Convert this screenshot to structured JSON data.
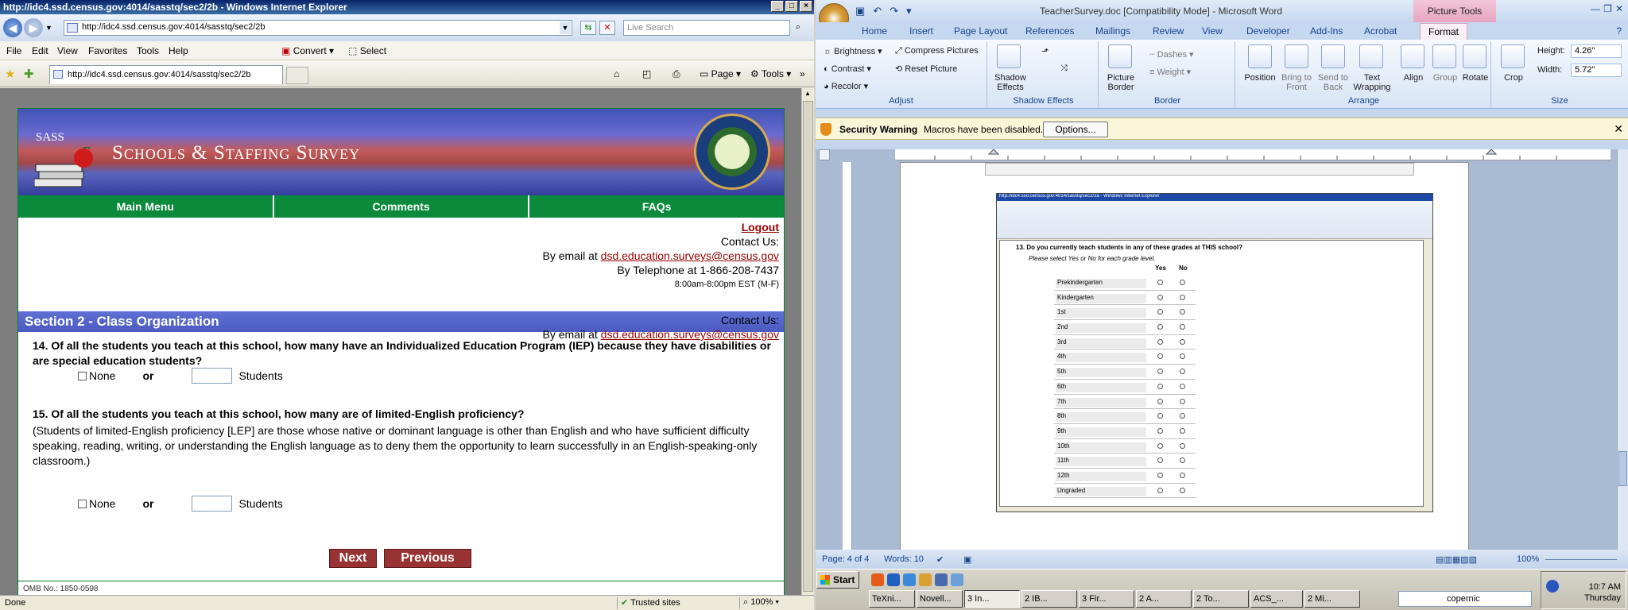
{
  "ie": {
    "window_title": "http://idc4.ssd.census.gov:4014/sasstq/sec2/2b - Windows Internet Explorer",
    "address": "http://idc4.ssd.census.gov:4014/sasstq/sec2/2b",
    "search_placeholder": "Live Search",
    "menu": [
      "File",
      "Edit",
      "View",
      "Favorites",
      "Tools",
      "Help"
    ],
    "convert_label": "Convert",
    "select_label": "Select",
    "tab_title": "http://idc4.ssd.census.gov:4014/sasstq/sec2/2b",
    "page_label": "Page",
    "tools_label": "Tools",
    "status": {
      "done": "Done",
      "zone": "Trusted sites",
      "zoom": "100%"
    }
  },
  "survey": {
    "sass": "SASS",
    "title": "Schools & Staffing Survey",
    "nav": [
      "Main Menu",
      "Comments",
      "FAQs"
    ],
    "logout": "Logout",
    "contact_label": "Contact Us:",
    "email_prefix": "By email at",
    "email": "dsd.education.surveys@census.gov",
    "phone": "By Telephone at 1-866-208-7437",
    "hours": "8:00am-8:00pm EST (M-F)",
    "section_title": "Section 2 - Class Organization",
    "q14": "14. Of all the students you teach at this school, how many have an Individualized Education Program (IEP) because they have disabilities or are special education students?",
    "q15": "15. Of all the students you teach at this school, how many are of limited-English proficiency?",
    "q15_note": "(Students of limited-English proficiency [LEP] are those whose native or dominant language is other than English and who have sufficient difficulty speaking, reading, writing, or understanding the English language as to deny them the opportunity to learn successfully in an English-speaking-only classroom.)",
    "none_label": "None",
    "or_label": "or",
    "students_label": "Students",
    "next": "Next",
    "previous": "Previous",
    "omb": "OMB No.: 1850-0598"
  },
  "word": {
    "title": "TeacherSurvey.doc [Compatibility Mode] - Microsoft Word",
    "picture_tools": "Picture Tools",
    "tabs": [
      "Home",
      "Insert",
      "Page Layout",
      "References",
      "Mailings",
      "Review",
      "View",
      "Developer",
      "Add-Ins",
      "Acrobat",
      "Format"
    ],
    "adjust": {
      "brightness": "Brightness",
      "contrast": "Contrast",
      "recolor": "Recolor",
      "compress": "Compress Pictures",
      "reset": "Reset Picture",
      "label": "Adjust"
    },
    "shadow": {
      "btn": "Shadow Effects",
      "label": "Shadow Effects"
    },
    "border": {
      "picture_border": "Picture Border",
      "dashes": "Dashes",
      "weight": "Weight",
      "label": "Border"
    },
    "arrange": {
      "position": "Position",
      "bring": "Bring to Front",
      "send": "Send to Back",
      "wrap": "Text Wrapping",
      "align": "Align",
      "group": "Group",
      "rotate": "Rotate",
      "label": "Arrange"
    },
    "size": {
      "crop": "Crop",
      "height_label": "Height:",
      "height": "4.26\"",
      "width_label": "Width:",
      "width": "5.72\"",
      "label": "Size"
    },
    "security": {
      "title": "Security Warning",
      "msg": "Macros have been disabled.",
      "options": "Options..."
    },
    "status": {
      "page": "Page: 4 of 4",
      "words": "Words: 10",
      "zoom": "100%"
    },
    "embedded": {
      "bar": "http://idc4.ssd.census.gov:4014/sasstq/sec2/2a - Windows Internet Explorer",
      "question": "13. Do you currently teach students in any of these grades at THIS school?",
      "hint": "Please select Yes or No for each grade level.",
      "yes": "Yes",
      "no": "No",
      "grades": [
        "Prekindergarten",
        "Kindergarten",
        "1st",
        "2nd",
        "3rd",
        "4th",
        "5th",
        "6th",
        "7th",
        "8th",
        "9th",
        "10th",
        "11th",
        "12th",
        "Ungraded"
      ]
    }
  },
  "taskbar": {
    "start": "Start",
    "buttons": [
      "TeXni...",
      "Novell...",
      "3 In...",
      "2 IB...",
      "3 Fir...",
      "2 A...",
      "2 To...",
      "ACS_...",
      "2 Mi..."
    ],
    "search": "copernic",
    "time": "10:7 AM",
    "day": "Thursday"
  }
}
